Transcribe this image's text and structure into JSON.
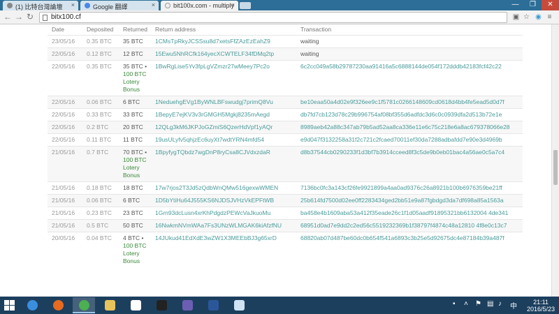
{
  "browser": {
    "tabs": [
      {
        "label": "(1) 比特台灣論壇",
        "close": "×"
      },
      {
        "label": "Google 翻譯",
        "close": "×"
      },
      {
        "label": "bit100x.com - multiply",
        "close": "×"
      }
    ],
    "window_controls": {
      "minimize": "—",
      "maximize": "❐",
      "close": "✕"
    },
    "url": "bitx100.cf",
    "accent": "#2c6e97"
  },
  "table": {
    "headers": [
      "Date",
      "Deposited",
      "Returned",
      "Return address",
      "Transaction"
    ],
    "rows": [
      {
        "date": "23/05/16",
        "deposited": "0.35 BTC",
        "returned": "35 BTC",
        "bonus": [],
        "address": "1CMsTpRkyJCSSsu8d7xetsFfZAzEzEahZ9",
        "tx": "waiting",
        "waiting": true
      },
      {
        "date": "22/05/16",
        "deposited": "0.12 BTC",
        "returned": "12 BTC",
        "bonus": [],
        "address": "15Ewu5NhRCfk164yecXCWTELF34fDMq2tp",
        "tx": "waiting",
        "waiting": true
      },
      {
        "date": "22/05/16",
        "deposited": "0.35 BTC",
        "returned": "35 BTC •",
        "bonus": [
          "100 BTC",
          "Lotery",
          "Bonus"
        ],
        "address": "1BwRgLise5Yv3fpLgVZmzr27wMeey7Pc2o",
        "tx": "6c2cc049a58b29787230aa91416a5c6888144de054f172dddb42183fcf42c22",
        "waiting": false
      },
      {
        "date": "22/05/16",
        "deposited": "0.06 BTC",
        "returned": "6 BTC",
        "bonus": [],
        "address": "1NeduehgEVg1ByWNLBFswudgj7primQ8Vu",
        "tx": "be10eaa50a4d02e9f326ee9c1f5781c0266148609cd0618d4bb4fe5ead5d0d7f",
        "waiting": false
      },
      {
        "date": "22/05/16",
        "deposited": "0.33 BTC",
        "returned": "33 BTC",
        "bonus": [],
        "address": "1BepyE7ejKV3v3rGMGH5Mgkj8235mAegd",
        "tx": "db7fd7cb123d78c29b996754af08bf355d6adfdc3d6c0c0939dfa2d513b72e1e",
        "waiting": false
      },
      {
        "date": "22/05/16",
        "deposited": "0.2 BTC",
        "returned": "20 BTC",
        "bonus": [],
        "address": "12QLg3kM6JKPJoGZmiS6QzerHdVpf1yAQr",
        "tx": "8989aeb42a88c347ab79b5ad52aa8ca336e11e6c75c218e6a8ac679378066e28",
        "waiting": false
      },
      {
        "date": "22/05/16",
        "deposited": "0.11 BTC",
        "returned": "11 BTC",
        "bonus": [],
        "address": "19usULyfv5qhjzEc6uyXt7wdtYRN4mfd54",
        "tx": "e9d047f3132258a31f2c721c2fcaed70011ef30da7288adbafdd7e90e3d4969b",
        "waiting": false
      },
      {
        "date": "21/05/16",
        "deposited": "0.7 BTC",
        "returned": "70 BTC •",
        "bonus": [
          "100 BTC",
          "Lotery",
          "Bonus"
        ],
        "address": "1BpyfygTQbdz7wgDnP8ryCsa8CJVdxzdaR",
        "tx": "d8b37544cb0290233f1d3bf7b3914cceed8f3c5de9b0eb01bac4a56ae0c5a7c4",
        "waiting": false
      },
      {
        "date": "21/05/16",
        "deposited": "0.18 BTC",
        "returned": "18 BTC",
        "bonus": [],
        "address": "17w7rjos2T3Jd5zQdbWnQMw516gexwWMEN",
        "tx": "7136bc0fc3a143cf26fe9921899a4aa0ad9376c26a8921b100b6976359be21ff",
        "waiting": false
      },
      {
        "date": "21/05/16",
        "deposited": "0.06 BTC",
        "returned": "6 BTC",
        "bonus": [],
        "address": "1D5bYtiHu64J555KS6NJDSJVHzVkEPFtWB",
        "tx": "25b614fd7500d02ee0ff2283434ged2bb51e9a87fgbdgd3da7df698a85a1563a",
        "waiting": false
      },
      {
        "date": "21/05/16",
        "deposited": "0.23 BTC",
        "returned": "23 BTC",
        "bonus": [],
        "address": "1Grn93dcLusn4xrKhPdgdzPEWcVaJkuoMu",
        "tx": "ba458e4b1609aba53a412f35eade26c1f1d05aadf91895321bb6132004 4de341",
        "waiting": false
      },
      {
        "date": "21/05/16",
        "deposited": "0.5 BTC",
        "returned": "50 BTC",
        "bonus": [],
        "address": "16NwkmNVmWAa7Fs3UNzWLMGAK6kiAfzfNU",
        "tx": "68951d0ad7e9dd2c2ed56c5519232369b1f38797f4874c48a12810 4f8e0c13c7",
        "waiting": false
      },
      {
        "date": "20/05/16",
        "deposited": "0.04 BTC",
        "returned": "4 BTC •",
        "bonus": [
          "100 BTC",
          "Lotery",
          "Bonus"
        ],
        "address": "14JUkud41EdXdE3wZW1X3MEEbBJ3g65xrD",
        "tx": "68820ab07d487be60dc0b654f541a6893c3b25e5d92675dc4e87184b39a487f",
        "waiting": false
      }
    ]
  },
  "taskbar": {
    "items": [
      {
        "name": "internet-explorer",
        "color": "#3b8ede"
      },
      {
        "name": "firefox",
        "color": "#e66a1f"
      },
      {
        "name": "chrome",
        "color": "#4caf50"
      },
      {
        "name": "file-explorer",
        "color": "#e8c25a"
      },
      {
        "name": "home",
        "color": "#ffffff"
      },
      {
        "name": "command-prompt",
        "color": "#222222"
      },
      {
        "name": "archive",
        "color": "#6c5fb3"
      },
      {
        "name": "word",
        "color": "#2b579a"
      },
      {
        "name": "notepad",
        "color": "#cfe3f5"
      }
    ],
    "time": "21:11",
    "date": "2016/5/23"
  }
}
